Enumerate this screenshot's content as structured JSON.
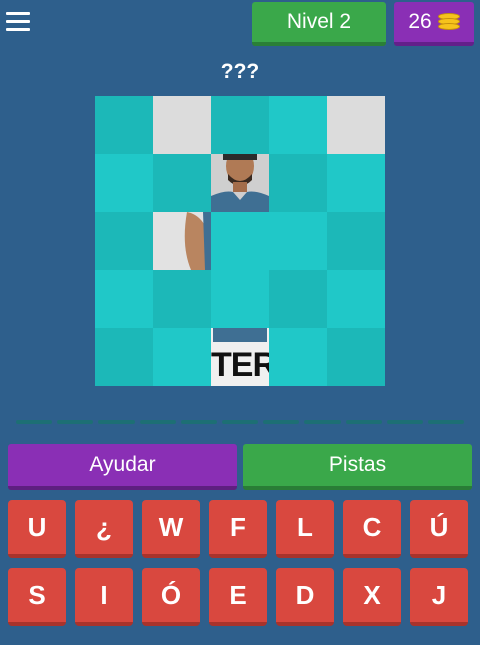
{
  "header": {
    "level_label": "Nivel 2",
    "coins": "26",
    "coin_icon": "coins-icon",
    "menu_icon": "hamburger-menu-icon"
  },
  "puzzle": {
    "title": "???",
    "overlay_text": "TER",
    "tiles": [
      [
        "dark",
        "open",
        "dark",
        "light",
        "open"
      ],
      [
        "light",
        "dark",
        "open",
        "dark",
        "light"
      ],
      [
        "dark",
        "open",
        "light",
        "light",
        "dark"
      ],
      [
        "light",
        "dark",
        "light",
        "dark",
        "light"
      ],
      [
        "dark",
        "light",
        "open",
        "light",
        "dark"
      ]
    ]
  },
  "answer": {
    "slot_count": 11
  },
  "actions": {
    "help_label": "Ayudar",
    "hints_label": "Pistas"
  },
  "keyboard": {
    "rows": [
      [
        "U",
        "¿",
        "W",
        "F",
        "L",
        "C",
        "Ú"
      ],
      [
        "S",
        "I",
        "Ó",
        "E",
        "D",
        "X",
        "J"
      ]
    ]
  },
  "colors": {
    "background": "#2e5f8c",
    "green": "#3aa84a",
    "purple": "#8a2fb5",
    "key_red": "#d9483f",
    "tile_teal": "#1cb8b8"
  }
}
